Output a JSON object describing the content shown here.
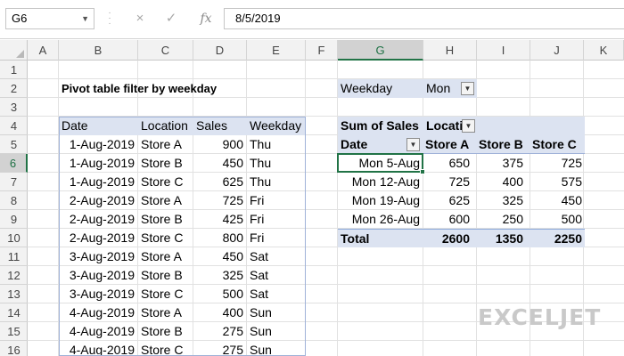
{
  "formula_bar": {
    "name_box": "G6",
    "cancel_icon": "×",
    "enter_icon": "✓",
    "fx_label": "fx",
    "formula": "8/5/2019"
  },
  "columns": [
    "A",
    "B",
    "C",
    "D",
    "E",
    "F",
    "G",
    "H",
    "I",
    "J",
    "K"
  ],
  "rows": [
    "1",
    "2",
    "3",
    "4",
    "5",
    "6",
    "7",
    "8",
    "9",
    "10",
    "11",
    "12",
    "13",
    "14",
    "15",
    "16"
  ],
  "selected": {
    "column": "G",
    "row": "6"
  },
  "title": "Pivot table filter by weekday",
  "data_table": {
    "headers": [
      "Date",
      "Location",
      "Sales",
      "Weekday"
    ],
    "rows": [
      [
        "1-Aug-2019",
        "Store A",
        "900",
        "Thu"
      ],
      [
        "1-Aug-2019",
        "Store B",
        "450",
        "Thu"
      ],
      [
        "1-Aug-2019",
        "Store C",
        "625",
        "Thu"
      ],
      [
        "2-Aug-2019",
        "Store A",
        "725",
        "Fri"
      ],
      [
        "2-Aug-2019",
        "Store B",
        "425",
        "Fri"
      ],
      [
        "2-Aug-2019",
        "Store C",
        "800",
        "Fri"
      ],
      [
        "3-Aug-2019",
        "Store A",
        "450",
        "Sat"
      ],
      [
        "3-Aug-2019",
        "Store B",
        "325",
        "Sat"
      ],
      [
        "3-Aug-2019",
        "Store C",
        "500",
        "Sat"
      ],
      [
        "4-Aug-2019",
        "Store A",
        "400",
        "Sun"
      ],
      [
        "4-Aug-2019",
        "Store B",
        "275",
        "Sun"
      ],
      [
        "4-Aug-2019",
        "Store C",
        "275",
        "Sun"
      ]
    ]
  },
  "pivot": {
    "filter_label": "Weekday",
    "filter_value": "Mon",
    "values_label": "Sum of Sales",
    "columns_label": "Locati",
    "rows_label": "Date",
    "column_headers": [
      "Store A",
      "Store B",
      "Store C"
    ],
    "rows": [
      [
        "Mon 5-Aug",
        "650",
        "375",
        "725"
      ],
      [
        "Mon 12-Aug",
        "725",
        "400",
        "575"
      ],
      [
        "Mon 19-Aug",
        "625",
        "325",
        "450"
      ],
      [
        "Mon 26-Aug",
        "600",
        "250",
        "500"
      ]
    ],
    "total_label": "Total",
    "totals": [
      "2600",
      "1350",
      "2250"
    ]
  },
  "logo_text": "EXCELJET"
}
